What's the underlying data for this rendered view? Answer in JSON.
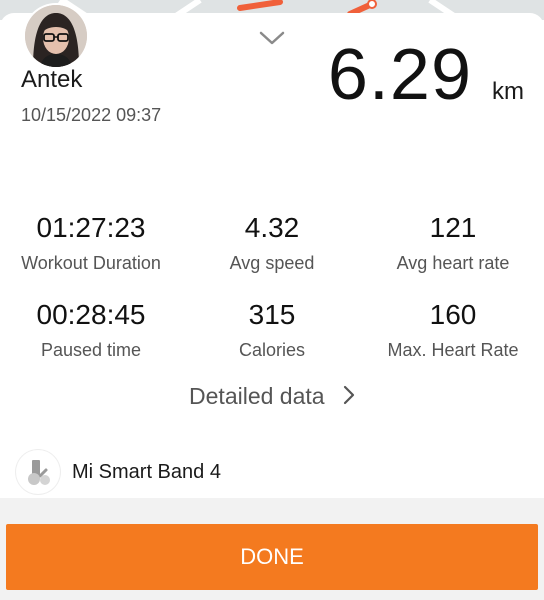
{
  "user": {
    "name": "Antek",
    "date": "10/15/2022 09:37"
  },
  "summary": {
    "distance_value": "6.29",
    "distance_unit": "km"
  },
  "stats": [
    {
      "value": "01:27:23",
      "label": "Workout Duration"
    },
    {
      "value": "4.32",
      "label": "Avg speed"
    },
    {
      "value": "121",
      "label": "Avg heart rate"
    },
    {
      "value": "00:28:45",
      "label": "Paused time"
    },
    {
      "value": "315",
      "label": "Calories"
    },
    {
      "value": "160",
      "label": "Max. Heart Rate"
    }
  ],
  "links": {
    "detailed_data": "Detailed data"
  },
  "device": {
    "name": "Mi Smart Band 4"
  },
  "actions": {
    "done": "DONE"
  },
  "colors": {
    "accent": "#f47a1f",
    "route": "#f0603a"
  },
  "icons": {
    "collapse": "chevron-down-icon",
    "detailed_data": "chevron-right-icon",
    "device": "mi-band-icon"
  }
}
